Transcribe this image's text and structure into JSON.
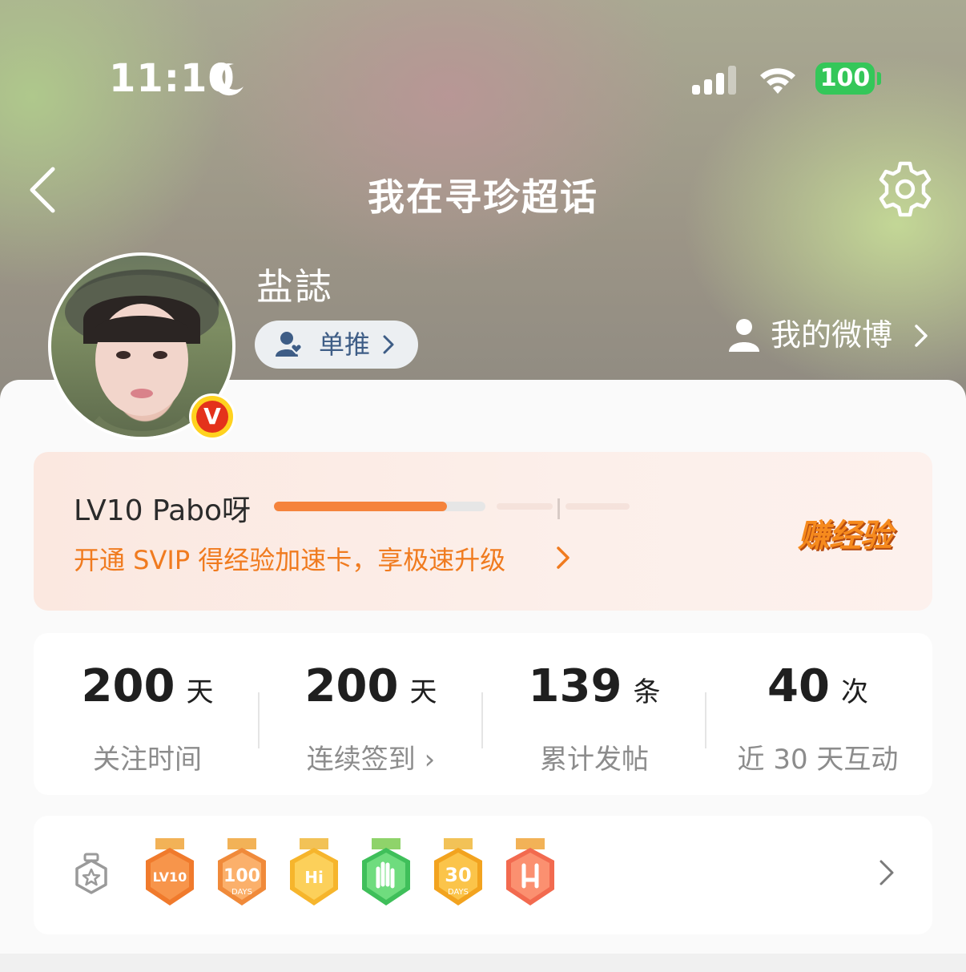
{
  "status_bar": {
    "time": "11:10",
    "battery": "100",
    "icons": [
      "moon-icon",
      "cellular-signal-icon",
      "wifi-icon",
      "battery-icon"
    ]
  },
  "nav": {
    "title": "我在寻珍超话",
    "icons": [
      "back-arrow-icon",
      "gear-icon"
    ]
  },
  "profile": {
    "username": "盐誌",
    "tag_label": "单推",
    "weibo_link_label": "我的微博",
    "verified_glyph": "V"
  },
  "level": {
    "text": "LV10 Pabo呀",
    "progress_fraction": 0.82,
    "svip_text": "开通 SVIP 得经验加速卡，享极速升级",
    "earn_label": "赚经验"
  },
  "stats": [
    {
      "value": "200",
      "unit": "天",
      "label": "关注时间"
    },
    {
      "value": "200",
      "unit": "天",
      "label": "连续签到 ›"
    },
    {
      "value": "139",
      "unit": "条",
      "label": "累计发帖"
    },
    {
      "value": "40",
      "unit": "次",
      "label": "近 30 天互动"
    }
  ],
  "medals": {
    "badge_labels": [
      "LV10",
      "100",
      "DAYS",
      "Hi",
      "30",
      "DAYS"
    ],
    "items": [
      {
        "name": "lv10-medal",
        "color": "#f07a2c"
      },
      {
        "name": "100-days-medal",
        "color": "#f08a3a"
      },
      {
        "name": "hi-medal",
        "color": "#f6b52c"
      },
      {
        "name": "hand-wave-medal",
        "color": "#3fbf5a"
      },
      {
        "name": "30-days-medal",
        "color": "#f2a31f"
      },
      {
        "name": "rock-hand-medal",
        "color": "#f26a4f"
      }
    ]
  },
  "colors": {
    "accent_orange": "#f07b1f",
    "progress": "#f5833c",
    "battery_green": "#34c759",
    "verified_red": "#e4321b",
    "verified_gold": "#ffd21f"
  }
}
